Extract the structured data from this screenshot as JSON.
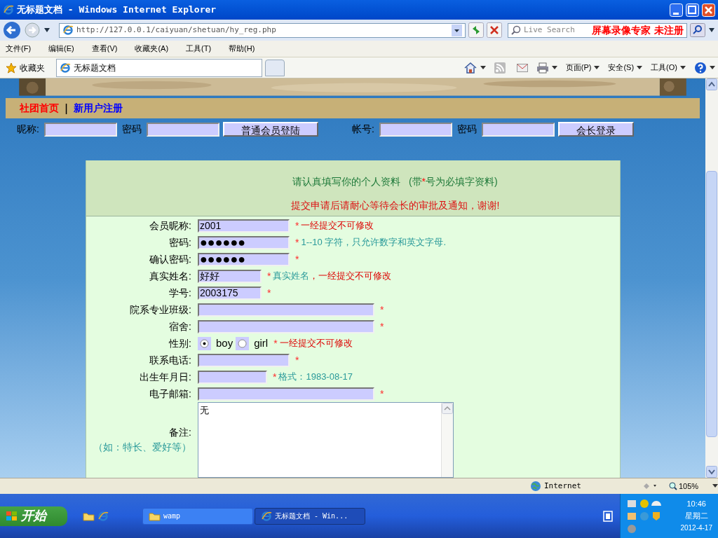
{
  "window": {
    "title": "无标题文档 - Windows Internet Explorer"
  },
  "address_bar": {
    "url": "http://127.0.0.1/caiyuan/shetuan/hy_reg.php"
  },
  "search": {
    "placeholder": "Live Search"
  },
  "recorder_notice": "屏幕录像专家 未注册",
  "menu": [
    "文件(F)",
    "编辑(E)",
    "查看(V)",
    "收藏夹(A)",
    "工具(T)",
    "帮助(H)"
  ],
  "favorites": {
    "label": "收藏夹"
  },
  "tabs": [
    {
      "label": "无标题文档",
      "selected": true
    }
  ],
  "command_bar": [
    "页面(P)",
    "安全(S)",
    "工具(O)"
  ],
  "nav": {
    "links": [
      {
        "label": "社团首页",
        "color": "#ff0000"
      },
      {
        "label": "新用户注册",
        "color": "#0000ff"
      }
    ],
    "separator": "|"
  },
  "login": [
    {
      "kind": "label",
      "text": "昵称:"
    },
    {
      "kind": "field"
    },
    {
      "kind": "label",
      "text": "密码"
    },
    {
      "kind": "field"
    },
    {
      "kind": "button",
      "text": "普通会员登陆"
    },
    {
      "kind": "gap"
    },
    {
      "kind": "label",
      "text": "帐号:"
    },
    {
      "kind": "field"
    },
    {
      "kind": "label",
      "text": "密码"
    },
    {
      "kind": "field"
    },
    {
      "kind": "button",
      "text": "会长登录"
    }
  ],
  "form": {
    "intro": {
      "before": "请认真填写你的个人资料   (带",
      "star": "*",
      "after": "号为必填字资料)"
    },
    "notice": "提交申请后请耐心等待会长的审批及通知，谢谢!",
    "fields": [
      {
        "kind": "field",
        "label": "会员昵称:",
        "value": "z001",
        "required": true,
        "note": [
          {
            "text": "一经提交不可修改",
            "color": "#dd0000"
          }
        ]
      },
      {
        "kind": "password",
        "label": "密码:",
        "value": "●●●●●●",
        "required": true,
        "note": [
          {
            "text": "1--10 字符，只允许数字和英文字母.",
            "color": "#2a9a9a"
          }
        ]
      },
      {
        "kind": "password",
        "label": "确认密码:",
        "value": "●●●●●●",
        "required": true
      },
      {
        "kind": "shortfield",
        "label": "真实姓名:",
        "value": "好好",
        "required": true,
        "note": [
          {
            "text": "真实姓名",
            "color": "#2a9a9a"
          },
          {
            "text": "，一经提交不可修改",
            "color": "#dd0000"
          }
        ]
      },
      {
        "kind": "shortfield",
        "label": "学号:",
        "value": "2003175",
        "required": true
      },
      {
        "kind": "longfield",
        "label": "院系专业班级:",
        "required": true
      },
      {
        "kind": "longfield",
        "label": "宿舍:",
        "required": true
      },
      {
        "kind": "radio",
        "label": "性别:",
        "options": [
          {
            "label": "boy",
            "selected": true
          },
          {
            "label": "girl",
            "selected": false
          }
        ],
        "required": true,
        "note": [
          {
            "text": "一经提交不可修改",
            "color": "#dd0000"
          }
        ]
      },
      {
        "kind": "field",
        "label": "联系电话:",
        "required": true
      },
      {
        "kind": "datefield",
        "label": "出生年月日:",
        "required": true,
        "note": [
          {
            "text": "格式：1983-08-17",
            "color": "#2a9a9a"
          }
        ]
      },
      {
        "kind": "longfield",
        "label": "电子邮箱:",
        "required": true
      },
      {
        "kind": "textarea",
        "label": "备注:",
        "hint": "（如：特长、爱好等）",
        "value": "无"
      }
    ]
  },
  "status_bar": {
    "zone": "Internet",
    "zoom": "105%"
  },
  "taskbar": {
    "start": "开始",
    "tasks": [
      {
        "label": "wamp",
        "selected": false
      },
      {
        "label": "无标题文档 - Win...",
        "selected": true
      }
    ],
    "time": "10:46",
    "day": "星期二",
    "date": "2012-4-17"
  }
}
